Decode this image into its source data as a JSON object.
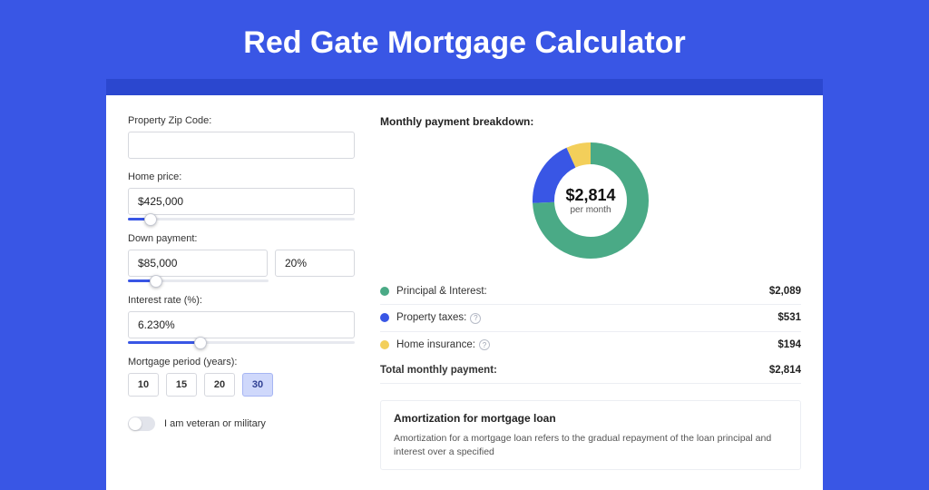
{
  "page_title": "Red Gate Mortgage Calculator",
  "form": {
    "zip_label": "Property Zip Code:",
    "zip_value": "",
    "home_price_label": "Home price:",
    "home_price_value": "$425,000",
    "home_price_slider_pct": 10,
    "down_payment_label": "Down payment:",
    "down_payment_value": "$85,000",
    "down_payment_pct_value": "20%",
    "down_payment_slider_pct": 20,
    "interest_label": "Interest rate (%):",
    "interest_value": "6.230%",
    "interest_slider_pct": 32,
    "period_label": "Mortgage period (years):",
    "periods": [
      "10",
      "15",
      "20",
      "30"
    ],
    "period_active": "30",
    "veteran_label": "I am veteran or military"
  },
  "breakdown": {
    "title": "Monthly payment breakdown:",
    "donut_amount": "$2,814",
    "donut_sub": "per month",
    "items": [
      {
        "label": "Principal & Interest:",
        "value": "$2,089",
        "color": "#4aaa86",
        "has_info": false
      },
      {
        "label": "Property taxes:",
        "value": "$531",
        "color": "#3956e5",
        "has_info": true
      },
      {
        "label": "Home insurance:",
        "value": "$194",
        "color": "#f3cf5a",
        "has_info": true
      }
    ],
    "total_label": "Total monthly payment:",
    "total_value": "$2,814"
  },
  "amort": {
    "title": "Amortization for mortgage loan",
    "text": "Amortization for a mortgage loan refers to the gradual repayment of the loan principal and interest over a specified"
  },
  "chart_data": {
    "type": "pie",
    "title": "Monthly payment breakdown",
    "total": 2814,
    "series": [
      {
        "name": "Principal & Interest",
        "value": 2089,
        "color": "#4aaa86"
      },
      {
        "name": "Property taxes",
        "value": 531,
        "color": "#3956e5"
      },
      {
        "name": "Home insurance",
        "value": 194,
        "color": "#f3cf5a"
      }
    ]
  }
}
